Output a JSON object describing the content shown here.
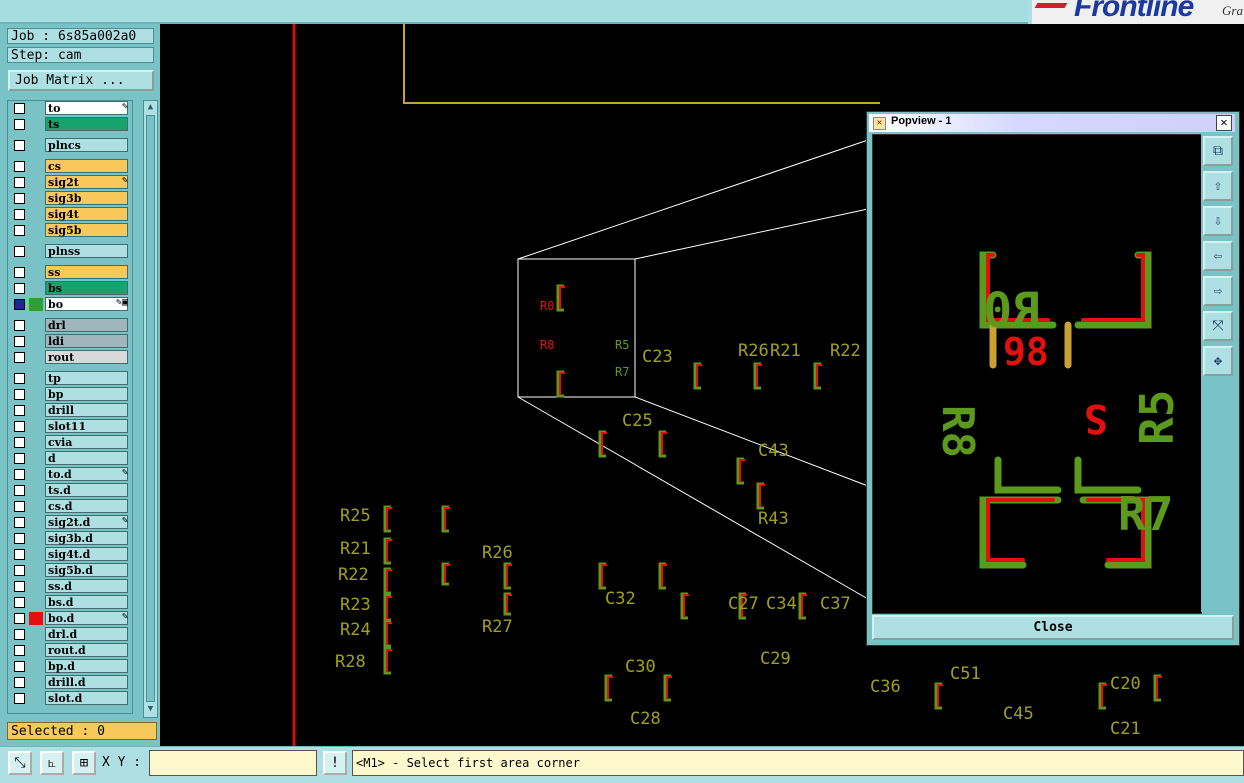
{
  "brand": {
    "name": "Frontline",
    "suffix": "Gra"
  },
  "job": {
    "job_label": "Job : 6s85a002a0",
    "step_label": "Step: cam",
    "matrix_button": "Job Matrix ..."
  },
  "layers": [
    {
      "name": "to",
      "color": "#ffffff",
      "mark": "✎"
    },
    {
      "name": "ts",
      "color": "#17a36b",
      "mark": ""
    },
    {
      "name": "plncs",
      "color": "#aee0e3",
      "mark": ""
    },
    {
      "name": "cs",
      "color": "#f7c85a",
      "mark": ""
    },
    {
      "name": "sig2t",
      "color": "#f7c85a",
      "mark": "✎"
    },
    {
      "name": "sig3b",
      "color": "#f7c85a",
      "mark": ""
    },
    {
      "name": "sig4t",
      "color": "#f7c85a",
      "mark": ""
    },
    {
      "name": "sig5b",
      "color": "#f7c85a",
      "mark": ""
    },
    {
      "name": "plnss",
      "color": "#aee0e3",
      "mark": ""
    },
    {
      "name": "ss",
      "color": "#f7c85a",
      "mark": ""
    },
    {
      "name": "bs",
      "color": "#17a36b",
      "mark": ""
    },
    {
      "name": "bo",
      "color": "#ffffff",
      "mark": "✎▣"
    },
    {
      "name": "drl",
      "color": "#9fb6ba",
      "mark": ""
    },
    {
      "name": "ldi",
      "color": "#9fb6ba",
      "mark": ""
    },
    {
      "name": "rout",
      "color": "#d9d9d9",
      "mark": ""
    },
    {
      "name": "tp",
      "color": "#aee0e3",
      "mark": ""
    },
    {
      "name": "bp",
      "color": "#aee0e3",
      "mark": ""
    },
    {
      "name": "drill",
      "color": "#aee0e3",
      "mark": ""
    },
    {
      "name": "slot11",
      "color": "#aee0e3",
      "mark": ""
    },
    {
      "name": "cvia",
      "color": "#aee0e3",
      "mark": ""
    },
    {
      "name": "d",
      "color": "#aee0e3",
      "mark": ""
    },
    {
      "name": "to.d",
      "color": "#aee0e3",
      "mark": "✎"
    },
    {
      "name": "ts.d",
      "color": "#aee0e3",
      "mark": ""
    },
    {
      "name": "cs.d",
      "color": "#aee0e3",
      "mark": ""
    },
    {
      "name": "sig2t.d",
      "color": "#aee0e3",
      "mark": "✎"
    },
    {
      "name": "sig3b.d",
      "color": "#aee0e3",
      "mark": ""
    },
    {
      "name": "sig4t.d",
      "color": "#aee0e3",
      "mark": ""
    },
    {
      "name": "sig5b.d",
      "color": "#aee0e3",
      "mark": ""
    },
    {
      "name": "ss.d",
      "color": "#aee0e3",
      "mark": ""
    },
    {
      "name": "bs.d",
      "color": "#aee0e3",
      "mark": ""
    },
    {
      "name": "bo.d",
      "color": "#aee0e3",
      "mark": "✎"
    },
    {
      "name": "drl.d",
      "color": "#aee0e3",
      "mark": ""
    },
    {
      "name": "rout.d",
      "color": "#aee0e3",
      "mark": ""
    },
    {
      "name": "bp.d",
      "color": "#aee0e3",
      "mark": ""
    },
    {
      "name": "drill.d",
      "color": "#aee0e3",
      "mark": ""
    },
    {
      "name": "slot.d",
      "color": "#aee0e3",
      "mark": ""
    }
  ],
  "selected": "Selected : 0",
  "bottom": {
    "xy_label": "X Y :",
    "xy_value": "",
    "message": "<M1> - Select first area corner"
  },
  "popup": {
    "title": "Popview - 1",
    "close_label": "Close",
    "close_x": "✕"
  },
  "canvas_labels": [
    "R25",
    "R21",
    "R22",
    "R23",
    "R24",
    "R28",
    "R26",
    "R27",
    "C25",
    "C43",
    "R43",
    "C32",
    "C27",
    "C34",
    "C37",
    "C30",
    "C28",
    "C29",
    "C36",
    "C51",
    "C45",
    "C20",
    "C21",
    "C23",
    "R26",
    "R21",
    "R22",
    "R0",
    "R8",
    "R5",
    "R7"
  ]
}
